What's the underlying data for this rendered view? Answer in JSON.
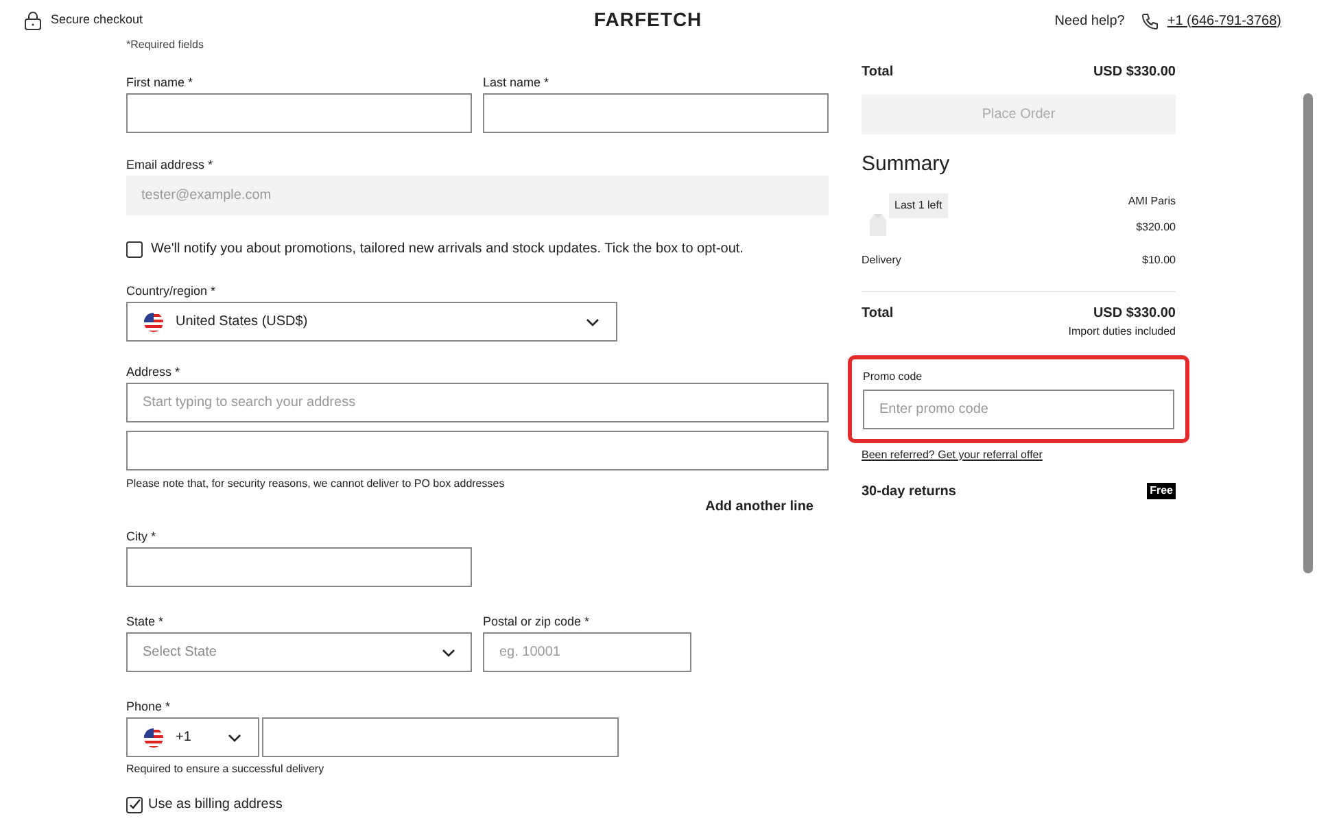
{
  "header": {
    "secure_label": "Secure checkout",
    "logo": "FARFETCH",
    "help_label": "Need help?",
    "phone_link": "+1 (646-791-3768)"
  },
  "form": {
    "required_note": "*Required fields",
    "first_name": {
      "label": "First name *"
    },
    "last_name": {
      "label": "Last name *"
    },
    "email": {
      "label": "Email address *",
      "placeholder": "tester@example.com",
      "disabled": true
    },
    "promotions": {
      "label": "We'll notify you about promotions, tailored new arrivals and stock updates. Tick the box to opt-out.",
      "checked": false
    },
    "country": {
      "label": "Country/region *",
      "value": "United States (USD$)"
    },
    "address": {
      "label": "Address *",
      "placeholder": "Start typing to search your address",
      "note": "Please note that, for security reasons, we cannot deliver to PO box addresses",
      "add_line": "Add another line"
    },
    "city": {
      "label": "City *"
    },
    "state": {
      "label": "State *",
      "placeholder": "Select State"
    },
    "postal": {
      "label": "Postal or zip code *",
      "placeholder": "eg. 10001"
    },
    "phone": {
      "label": "Phone *",
      "code": "+1",
      "note": "Required to ensure a successful delivery"
    },
    "billing": {
      "label": "Use as billing address",
      "checked": true
    }
  },
  "summary": {
    "total_label": "Total",
    "total_value": "USD $330.00",
    "place_order": {
      "label": "Place Order",
      "disabled": true
    },
    "title": "Summary",
    "item": {
      "badge": "Last 1 left",
      "brand": "AMI Paris",
      "price": "$320.00"
    },
    "delivery_label": "Delivery",
    "delivery_value": "$10.00",
    "grand_total_label": "Total",
    "grand_total_value": "USD $330.00",
    "duties_note": "Import duties included",
    "promo": {
      "label": "Promo code",
      "placeholder": "Enter promo code",
      "highlighted": true
    },
    "referral_link": "Been referred? Get your referral offer",
    "returns_label": "30-day returns",
    "returns_badge": "Free"
  }
}
